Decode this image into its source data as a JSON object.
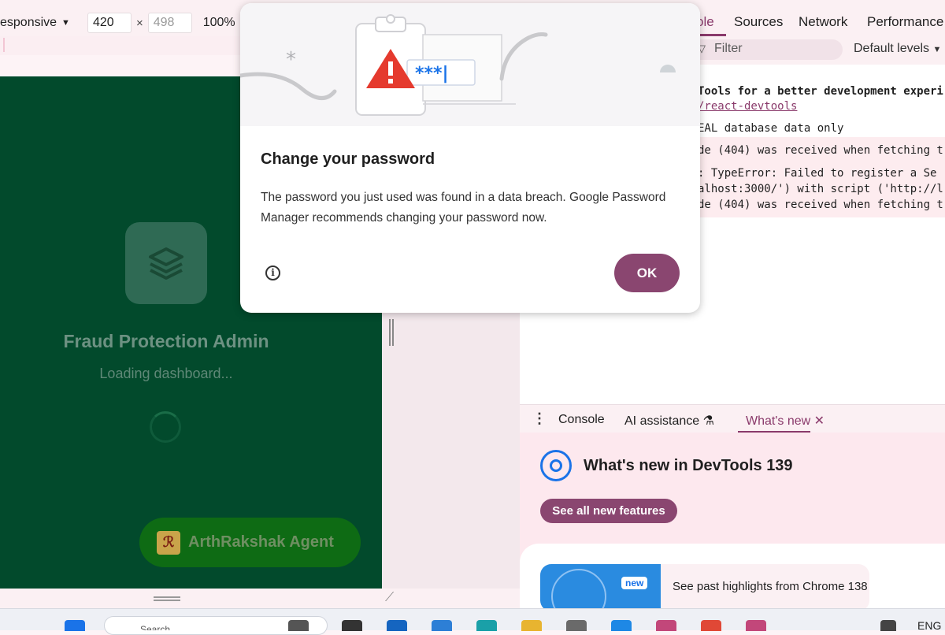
{
  "device_toolbar": {
    "device": "esponsive",
    "width": "420",
    "height_placeholder": "498",
    "times": "×",
    "zoom": "100%"
  },
  "viewport": {
    "app_title": "Fraud Protection Admin",
    "loading_text": "Loading dashboard...",
    "agent_button": "ArthRakshak Agent"
  },
  "devtools": {
    "tabs": [
      "ole",
      "Sources",
      "Network",
      "Performance"
    ],
    "filter_placeholder": "Filter",
    "levels": "Default levels",
    "console_lines": [
      "Tools for a better development experi",
      "/react-devtools",
      "EAL database data only",
      "de (404) was received when fetching t",
      ":  TypeError: Failed to register a Se",
      "alhost:3000/') with script ('http://l",
      "de (404) was received when fetching t"
    ],
    "drawer_tabs": [
      "Console",
      "AI assistance",
      "What's new"
    ],
    "whats_new": {
      "title": "What's new in DevTools 139",
      "button": "See all new features",
      "badge": "new",
      "card_text": "See past highlights from Chrome 138"
    }
  },
  "modal": {
    "title": "Change your password",
    "body": "The password you just used was found in a data breach. Google Password Manager recommends changing your password now.",
    "masked": "***|",
    "ok": "OK",
    "accent": "#8a4670"
  },
  "taskbar": {
    "search": "Search",
    "lang": "ENG"
  }
}
